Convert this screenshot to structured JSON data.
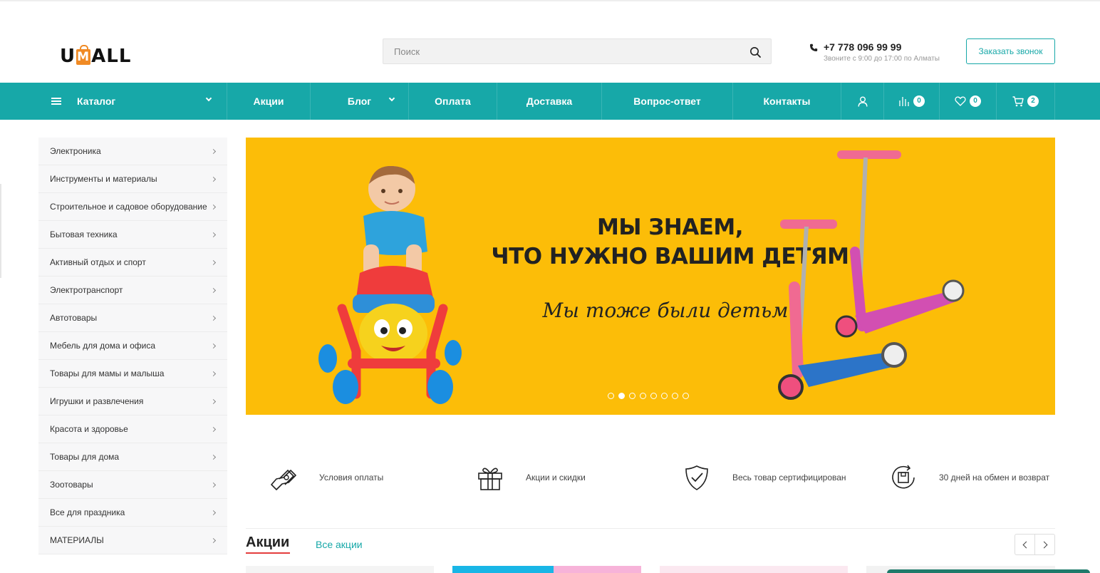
{
  "brand": {
    "logo_text_left": "U",
    "logo_text_right": "ALL",
    "accent_color": "#17a8a8",
    "logo_bag_color": "#f08a24"
  },
  "search": {
    "placeholder": "Поиск"
  },
  "contact": {
    "phone": "+7 778 096 99 99",
    "hours": "Звоните с 9:00 до 17:00 по Алматы",
    "call_button": "Заказать звонок"
  },
  "nav": {
    "catalog": "Каталог",
    "items": [
      "Акции",
      "Блог",
      "Оплата",
      "Доставка",
      "Вопрос-ответ",
      "Контакты"
    ],
    "compare_count": "0",
    "favorites_count": "0",
    "cart_count": "2"
  },
  "categories": [
    "Электроника",
    "Инструменты и материалы",
    "Строительное и садовое оборудование",
    "Бытовая техника",
    "Активный отдых и спорт",
    "Электротранспорт",
    "Автотовары",
    "Мебель для дома и офиса",
    "Товары для мамы и малыша",
    "Игрушки и развлечения",
    "Красота и здоровье",
    "Товары для дома",
    "Зоотовары",
    "Все для праздника",
    "МАТЕРИАЛЫ"
  ],
  "banner": {
    "line1": "МЫ ЗНАЕМ,",
    "line2": "ЧТО НУЖНО ВАШИМ ДЕТЯМ",
    "subtitle": "Мы тоже были детьми",
    "background": "#fcbd08",
    "slides": 8,
    "active_slide": 2
  },
  "features": [
    {
      "icon": "payment-hand-icon",
      "label": "Условия оплаты"
    },
    {
      "icon": "gift-icon",
      "label": "Акции и скидки"
    },
    {
      "icon": "shield-check-icon",
      "label": "Весь товар сертифицирован"
    },
    {
      "icon": "return-box-icon",
      "label": "30 дней на обмен и возврат"
    }
  ],
  "promo": {
    "title": "Акции",
    "all_link": "Все акции"
  }
}
